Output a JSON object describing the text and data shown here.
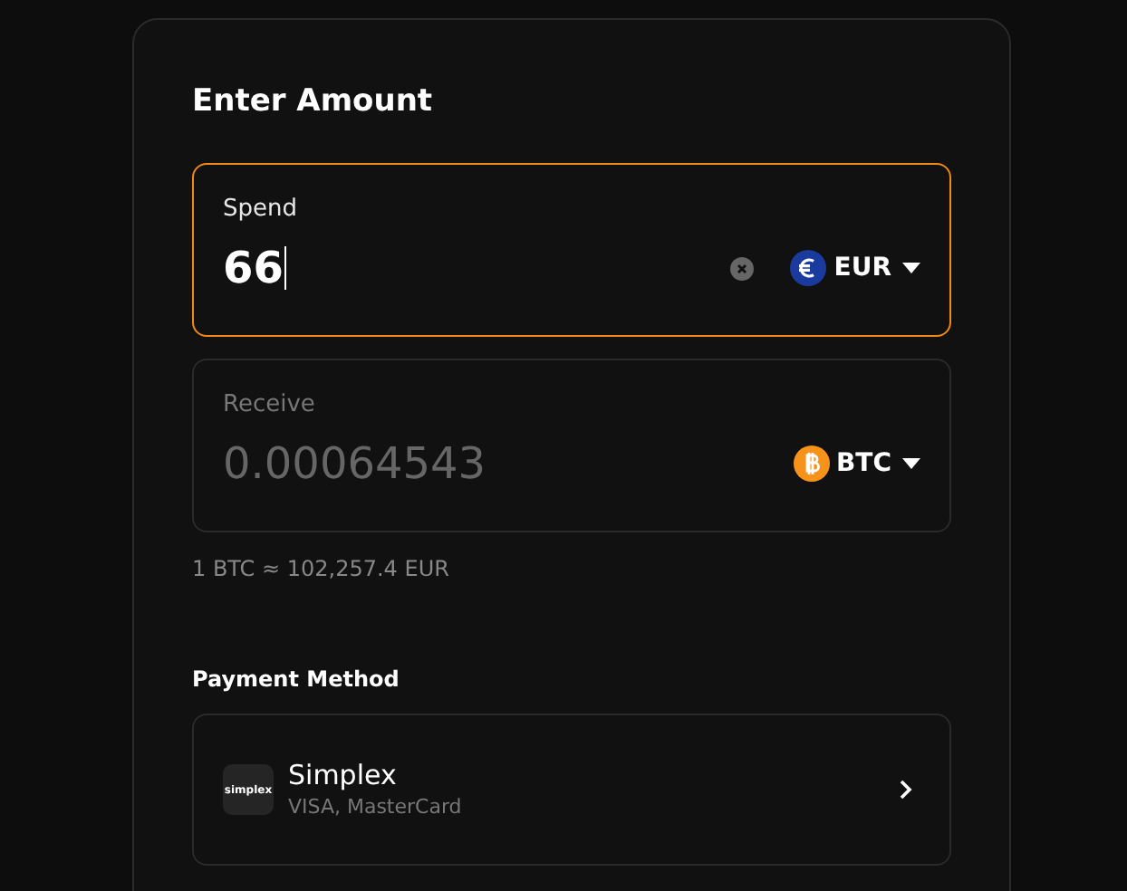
{
  "title": "Enter Amount",
  "fields": [
    {
      "label": "Spend",
      "value": "66",
      "focused": true,
      "disabled": false,
      "clearable": true,
      "currency": "EUR",
      "kind": "euro"
    },
    {
      "label": "Receive",
      "value": "0.00064543",
      "focused": false,
      "disabled": true,
      "clearable": false,
      "currency": "BTC",
      "kind": "bitcoin"
    }
  ],
  "rate": "1 BTC ≈ 102,257.4 EUR",
  "payment_method": {
    "heading": "Payment Method",
    "name": "Simplex",
    "logo_text": "simplex",
    "cards": "VISA, MasterCard"
  }
}
